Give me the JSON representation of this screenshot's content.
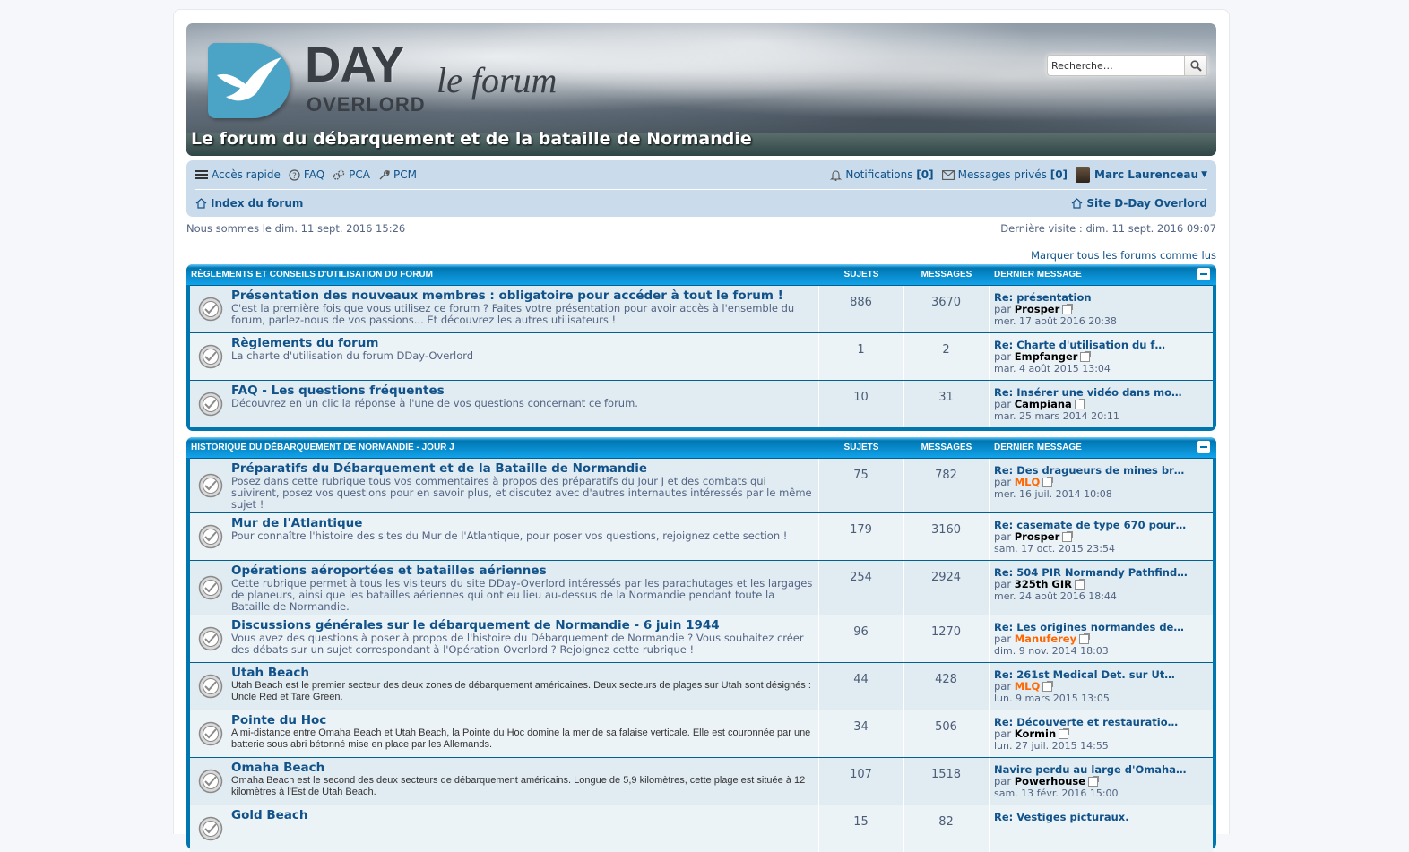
{
  "header": {
    "logo_day": "DAY",
    "logo_overlord": "OVERLORD",
    "logo_forum": "le forum",
    "site_description": "Le forum du débarquement et de la bataille de Normandie",
    "search_placeholder": "Recherche…"
  },
  "navbar": {
    "quick_access": "Accès rapide",
    "faq": "FAQ",
    "pca": "PCA",
    "pcm": "PCM",
    "notifications_label": "Notifications",
    "notifications_count": "[0]",
    "messages_label": "Messages privés",
    "messages_count": "[0]",
    "username": "Marc Laurenceau",
    "index_label": "Index du forum",
    "site_link": "Site D-Day Overlord"
  },
  "meta": {
    "current_time": "Nous sommes le dim. 11 sept. 2016 15:26",
    "last_visit": "Dernière visite : dim. 11 sept. 2016 09:07",
    "mark_read": "Marquer tous les forums comme lus"
  },
  "categories": [
    {
      "title": "Règlements et conseils d'utilisation du forum",
      "col_topics": "Sujets",
      "col_posts": "Messages",
      "col_last": "Dernier message",
      "forums": [
        {
          "title": "Présentation des nouveaux membres : obligatoire pour accéder à tout le forum !",
          "desc": "C'est la première fois que vous utilisez ce forum ? Faites votre présentation pour avoir accès à l'ensemble du forum, parlez-nous de vos passions... Et découvrez les autres utilisateurs !",
          "topics": "886",
          "posts": "3670",
          "last_title": "Re: présentation",
          "last_by": "par",
          "last_user": "Prosper",
          "last_time": "mer. 17 août 2016 20:38"
        },
        {
          "title": "Règlements du forum",
          "desc": "La charte d'utilisation du forum DDay-Overlord",
          "topics": "1",
          "posts": "2",
          "last_title": "Re: Charte d'utilisation du f…",
          "last_by": "par",
          "last_user": "Empfanger",
          "last_time": "mar. 4 août 2015 13:04"
        },
        {
          "title": "FAQ - Les questions fréquentes",
          "desc": " Découvrez en un clic la réponse à l'une de vos questions concernant ce forum.",
          "topics": "10",
          "posts": "31",
          "last_title": "Re: Insérer une vidéo dans mo…",
          "last_by": "par",
          "last_user": "Campiana",
          "last_time": "mar. 25 mars 2014 20:11"
        }
      ]
    },
    {
      "title": "Historique du débarquement de Normandie - Jour J",
      "col_topics": "Sujets",
      "col_posts": "Messages",
      "col_last": "Dernier message",
      "forums": [
        {
          "title": "Préparatifs du Débarquement et de la Bataille de Normandie",
          "desc": "Posez dans cette rubrique tous vos commentaires à propos des préparatifs du Jour J et des combats qui suivirent, posez vos questions pour en savoir plus, et discutez avec d'autres internautes intéressés par le même sujet !",
          "topics": "75",
          "posts": "782",
          "last_title": "Re: Des dragueurs de mines br…",
          "last_by": "par",
          "last_user": "MLQ",
          "last_time": "mer. 16 juil. 2014 10:08"
        },
        {
          "title": "Mur de l'Atlantique",
          "desc": "Pour connaître l'histoire des sites du Mur de l'Atlantique, pour poser vos questions, rejoignez cette section !",
          "topics": "179",
          "posts": "3160",
          "last_title": "Re: casemate de type 670 pour…",
          "last_by": "par",
          "last_user": "Prosper",
          "last_time": "sam. 17 oct. 2015 23:54"
        },
        {
          "title": "Opérations aéroportées et batailles aériennes",
          "desc": "Cette rubrique permet à tous les visiteurs du site DDay-Overlord intéressés par les parachutages et les largages de planeurs, ainsi que les batailles aériennes qui ont eu lieu au-dessus de la Normandie pendant toute la Bataille de Normandie.",
          "topics": "254",
          "posts": "2924",
          "last_title": "Re: 504 PIR Normandy Pathfind…",
          "last_by": "par",
          "last_user": "325th GIR",
          "last_time": "mer. 24 août 2016 18:44"
        },
        {
          "title": "Discussions générales sur le débarquement de Normandie - 6 juin 1944",
          "desc": "Vous avez des questions à poser à propos de l'histoire du Débarquement de Normandie ? Vous souhaitez créer des débats sur un sujet correspondant à l'Opération Overlord ? Rejoignez cette rubrique !",
          "topics": "96",
          "posts": "1270",
          "last_title": "Re: Les origines normandes de…",
          "last_by": "par",
          "last_user": "Manuferey",
          "last_time": "dim. 9 nov. 2014 18:03"
        },
        {
          "title": "Utah Beach",
          "desc": "Utah Beach est le premier secteur des deux zones de débarquement américaines. Deux secteurs de plages sur Utah sont désignés : Uncle Red et Tare Green.",
          "topics": "44",
          "posts": "428",
          "last_title": "Re: 261st Medical Det. sur Ut…",
          "last_by": "par",
          "last_user": "MLQ",
          "last_time": "lun. 9 mars 2015 13:05"
        },
        {
          "title": "Pointe du Hoc",
          "desc": "A mi-distance entre Omaha Beach et Utah Beach, la Pointe du Hoc domine la mer de sa falaise verticale. Elle est couronnée par une batterie sous abri bétonné mise en place par les Allemands.",
          "topics": "34",
          "posts": "506",
          "last_title": "Re: Découverte et restauratio…",
          "last_by": "par",
          "last_user": "Kormin",
          "last_time": "lun. 27 juil. 2015 14:55"
        },
        {
          "title": "Omaha Beach",
          "desc": "Omaha Beach est le second des deux secteurs de débarquement américains. Longue de 5,9 kilomètres, cette plage est située à 12 kilomètres à l'Est de Utah Beach.",
          "topics": "107",
          "posts": "1518",
          "last_title": "Navire perdu au large d'Omaha…",
          "last_by": "par",
          "last_user": "Powerhouse",
          "last_time": "sam. 13 févr. 2016 15:00"
        },
        {
          "title": "Gold Beach",
          "desc": "",
          "topics": "15",
          "posts": "82",
          "last_title": "Re: Vestiges picturaux.",
          "last_by": "",
          "last_user": "",
          "last_time": ""
        }
      ]
    }
  ],
  "colors": {
    "accent": "#0076b1",
    "link": "#105289",
    "navbar_bg": "#cadceb",
    "highlight_user": "#ff6600"
  }
}
